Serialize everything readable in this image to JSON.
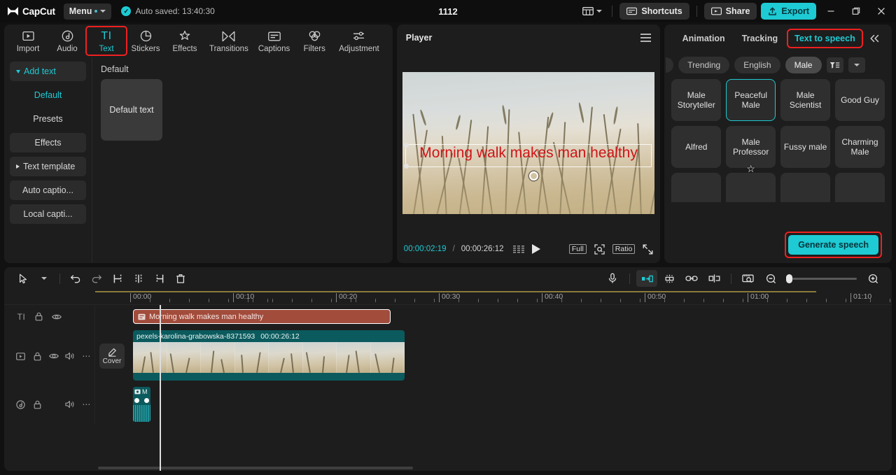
{
  "titlebar": {
    "brand": "CapCut",
    "menu_label": "Menu",
    "autosave": "Auto saved: 13:40:30",
    "project_title": "1112",
    "shortcuts_label": "Shortcuts",
    "share_label": "Share",
    "export_label": "Export",
    "minimize": "—",
    "maximize": "❐",
    "close": "×",
    "accent": "#1ecad3"
  },
  "function_tabs": [
    {
      "label": "Import",
      "icon": "import-icon"
    },
    {
      "label": "Audio",
      "icon": "audio-icon"
    },
    {
      "label": "Text",
      "icon": "text-icon",
      "glyph": "TI",
      "active": true,
      "highlighted": true
    },
    {
      "label": "Stickers",
      "icon": "stickers-icon"
    },
    {
      "label": "Effects",
      "icon": "effects-icon"
    },
    {
      "label": "Transitions",
      "icon": "transitions-icon"
    },
    {
      "label": "Captions",
      "icon": "captions-icon"
    },
    {
      "label": "Filters",
      "icon": "filters-icon"
    },
    {
      "label": "Adjustment",
      "icon": "adjustment-icon"
    }
  ],
  "text_sidebar": [
    {
      "label": "Add text",
      "style": "accent-expandable"
    },
    {
      "label": "Default",
      "style": "plain-selected"
    },
    {
      "label": "Presets",
      "style": "plain"
    },
    {
      "label": "Effects",
      "style": "button"
    },
    {
      "label": "Text template",
      "style": "expandable"
    },
    {
      "label": "Auto captio...",
      "style": "button"
    },
    {
      "label": "Local capti...",
      "style": "button"
    }
  ],
  "text_content": {
    "section_label": "Default",
    "card_label": "Default text"
  },
  "player": {
    "title": "Player",
    "menu_icon": "hamburger-icon",
    "current_time": "00:00:02:19",
    "separator": "/",
    "total_time": "00:00:26:12",
    "frames_icon": "frames-icon",
    "play_icon": "play-icon",
    "full_label": "Full",
    "zoom_icon": "zoom-fit-icon",
    "ratio_label": "Ratio",
    "fullscreen_icon": "fullscreen-icon",
    "overlay_text": "Morning walk makes man healthy",
    "overlay_color": "#d01417"
  },
  "right_panel": {
    "tabs": [
      {
        "label": "Animation",
        "active": false,
        "highlighted": false
      },
      {
        "label": "Tracking",
        "active": false,
        "highlighted": false
      },
      {
        "label": "Text to speech",
        "active": true,
        "highlighted": true
      }
    ],
    "collapse_icon": "collapse-right-icon",
    "filters": [
      {
        "label": "Trending",
        "selected": false
      },
      {
        "label": "English",
        "selected": false
      },
      {
        "label": "Male",
        "selected": true
      }
    ],
    "filter_icon": "filter-sort-icon",
    "dropdown_icon": "chevron-down-icon",
    "voices": [
      {
        "label": "Male Storyteller",
        "selected": false
      },
      {
        "label": "Peaceful Male",
        "selected": true
      },
      {
        "label": "Male Scientist",
        "selected": false
      },
      {
        "label": "Good Guy",
        "selected": false
      },
      {
        "label": "Alfred",
        "selected": false
      },
      {
        "label": "Male Professor",
        "selected": false,
        "cursor": "star-cursor"
      },
      {
        "label": "Fussy male",
        "selected": false
      },
      {
        "label": "Charming Male",
        "selected": false
      }
    ],
    "generate_label": "Generate speech"
  },
  "timeline": {
    "tools_left": [
      {
        "icon": "select-arrow-icon",
        "name": "select-tool"
      },
      {
        "icon": "chevron-down-icon",
        "name": "select-tool-dropdown"
      },
      {
        "icon": "undo-icon",
        "name": "undo-button"
      },
      {
        "icon": "redo-icon",
        "name": "redo-button"
      },
      {
        "icon": "split-icon",
        "name": "split-button"
      },
      {
        "icon": "trim-left-icon",
        "name": "trim-left-button"
      },
      {
        "icon": "trim-right-icon",
        "name": "trim-right-button"
      },
      {
        "icon": "delete-icon",
        "name": "delete-button"
      }
    ],
    "tools_right": [
      {
        "icon": "mic-icon",
        "name": "record-voiceover-button"
      },
      {
        "icon": "keyframe-icon",
        "name": "mirror-button",
        "active": true
      },
      {
        "icon": "freeze-icon",
        "name": "freeze-button"
      },
      {
        "icon": "link-icon",
        "name": "link-clips-button"
      },
      {
        "icon": "crop-split-icon",
        "name": "crop-button"
      },
      {
        "icon": "preview-icon",
        "name": "timeline-preview-button"
      },
      {
        "icon": "zoom-out-icon",
        "name": "zoom-out-button"
      },
      {
        "icon": "zoom-in-icon",
        "name": "zoom-in-button"
      }
    ],
    "ruler_labels": [
      "00:00",
      "00:10",
      "00:20",
      "00:30",
      "00:40",
      "00:50",
      "01:00",
      "01:10"
    ],
    "tracks": [
      {
        "type": "text",
        "head_icons": [
          "TI",
          "lock-icon",
          "eye-icon"
        ],
        "clip": {
          "label": "Morning walk makes man healthy",
          "icon": "text-clip-icon",
          "color": "#a24c3c"
        }
      },
      {
        "type": "video",
        "head_icons": [
          "video-icon",
          "lock-icon",
          "eye-icon",
          "volume-icon",
          "more-icon"
        ],
        "cover_label": "Cover",
        "clip": {
          "name": "pexels-karolina-grabowska-8371593",
          "duration": "00:00:26:12",
          "color": "#0b5a5d"
        }
      },
      {
        "type": "audio",
        "head_icons": [
          "audio-icon",
          "lock-icon",
          "volume-icon",
          "more-icon"
        ],
        "clip": {
          "label": "M",
          "color": "#0b5a5d"
        }
      }
    ]
  }
}
